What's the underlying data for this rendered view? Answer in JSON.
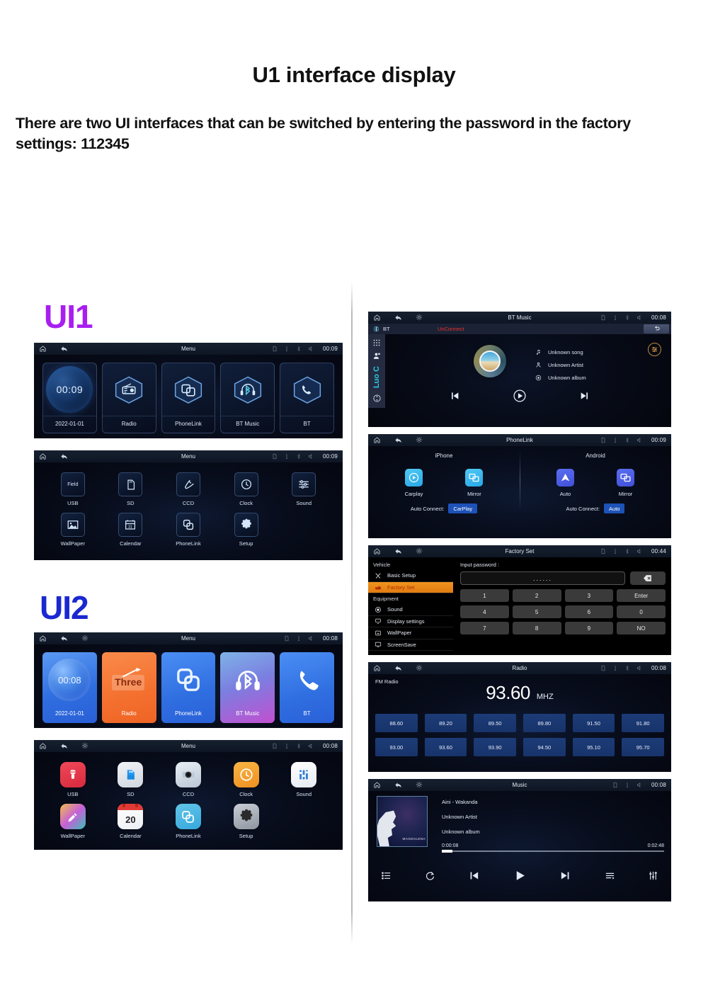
{
  "header": {
    "title": "U1 interface display",
    "subtitle": "There are two UI interfaces that can be switched by entering the password in the factory settings: 112345"
  },
  "labels": {
    "ui1": "UI1",
    "ui2": "UI2",
    "ui1_color": "#a81ef0",
    "ui2_color": "#1a28d0"
  },
  "ui1_home": {
    "statusbar": {
      "title": "Menu",
      "time": "00:09"
    },
    "tiles": [
      {
        "label": "2022-01-01",
        "icon": "clock-sphere-icon",
        "value": "00:09"
      },
      {
        "label": "Radio",
        "icon": "radio-icon"
      },
      {
        "label": "PhoneLink",
        "icon": "phonelink-icon"
      },
      {
        "label": "BT Music",
        "icon": "bt-music-icon"
      },
      {
        "label": "BT",
        "icon": "phone-icon"
      }
    ]
  },
  "ui1_apps": {
    "statusbar": {
      "title": "Menu",
      "time": "00:09"
    },
    "row1": [
      {
        "label": "USB",
        "icon": "usb-icon",
        "badge": "Field"
      },
      {
        "label": "SD",
        "icon": "sd-card-icon"
      },
      {
        "label": "CCD",
        "icon": "camera-plug-icon"
      },
      {
        "label": "Clock",
        "icon": "clock-icon"
      },
      {
        "label": "Sound",
        "icon": "sound-sliders-icon"
      }
    ],
    "row2": [
      {
        "label": "WallPaper",
        "icon": "image-icon"
      },
      {
        "label": "Calendar",
        "icon": "calendar-icon",
        "day": "31"
      },
      {
        "label": "PhoneLink",
        "icon": "phonelink-icon"
      },
      {
        "label": "Setup",
        "icon": "gear-icon"
      }
    ]
  },
  "ui2_home": {
    "statusbar": {
      "title": "Menu",
      "time": "00:08"
    },
    "tiles": [
      {
        "label": "2022-01-01",
        "icon": "clock-sphere-icon",
        "value": "00:08"
      },
      {
        "label": "Radio",
        "icon": "radio-icon",
        "badge": "Three"
      },
      {
        "label": "PhoneLink",
        "icon": "phonelink-icon"
      },
      {
        "label": "BT Music",
        "icon": "bt-music-icon"
      },
      {
        "label": "BT",
        "icon": "phone-icon"
      }
    ]
  },
  "ui2_apps": {
    "statusbar": {
      "title": "Menu",
      "time": "00:08"
    },
    "row1": [
      {
        "label": "USB",
        "icon": "usb-icon"
      },
      {
        "label": "SD",
        "icon": "sd-card-icon"
      },
      {
        "label": "CCD",
        "icon": "camera-icon"
      },
      {
        "label": "Clock",
        "icon": "clock-icon"
      },
      {
        "label": "Sound",
        "icon": "sound-sliders-icon"
      }
    ],
    "row2": [
      {
        "label": "WallPaper",
        "icon": "image-icon"
      },
      {
        "label": "Calendar",
        "icon": "calendar-icon",
        "day": "20"
      },
      {
        "label": "PhoneLink",
        "icon": "phonelink-icon"
      },
      {
        "label": "Setup",
        "icon": "gear-icon"
      }
    ]
  },
  "bt_music": {
    "statusbar": {
      "title": "BT Music",
      "time": "00:08"
    },
    "subbar": {
      "device": "BT",
      "status": "UnConnect"
    },
    "rail": {
      "vertical_text": "Luo C"
    },
    "meta": [
      {
        "icon": "music-note-icon",
        "text": "Unknown song"
      },
      {
        "icon": "person-icon",
        "text": "Unknown Artist"
      },
      {
        "icon": "disc-icon",
        "text": "Unknown album"
      }
    ],
    "controls": [
      "prev-icon",
      "play-icon",
      "next-icon"
    ]
  },
  "phonelink": {
    "statusbar": {
      "title": "PhoneLink",
      "time": "00:09"
    },
    "iphone": {
      "heading": "iPhone",
      "items": [
        {
          "label": "Carplay",
          "icon": "carplay-icon"
        },
        {
          "label": "Mirror",
          "icon": "mirror-icon"
        }
      ],
      "auto_connect_label": "Auto Connect:",
      "auto_connect_value": "CarPlay"
    },
    "android": {
      "heading": "Android",
      "items": [
        {
          "label": "Auto",
          "icon": "android-auto-icon"
        },
        {
          "label": "Mirror",
          "icon": "mirror-icon"
        }
      ],
      "auto_connect_label": "Auto Connect:",
      "auto_connect_value": "Auto"
    }
  },
  "factory_set": {
    "statusbar": {
      "title": "Factory Set",
      "time": "00:44"
    },
    "sidebar": [
      {
        "type": "group",
        "label": "Vehicle"
      },
      {
        "type": "item",
        "label": "Basic Setup",
        "icon": "tools-icon",
        "active": false
      },
      {
        "type": "item",
        "label": "Factory Set",
        "icon": "factory-icon",
        "active": true
      },
      {
        "type": "group",
        "label": "Equipment"
      },
      {
        "type": "item",
        "label": "Sound",
        "icon": "speaker-icon",
        "active": false
      },
      {
        "type": "item",
        "label": "Display settings",
        "icon": "display-icon",
        "active": false
      },
      {
        "type": "item",
        "label": "WallPaper",
        "icon": "wallpaper-icon",
        "active": false
      },
      {
        "type": "item",
        "label": "ScreenSave",
        "icon": "screen-icon",
        "active": false
      }
    ],
    "input_label": "Input password :",
    "password_value": "......",
    "delete_icon": "backspace-icon",
    "keys": [
      "1",
      "2",
      "3",
      "Enter",
      "4",
      "5",
      "6",
      "0",
      "7",
      "8",
      "9",
      "NO"
    ]
  },
  "radio": {
    "statusbar": {
      "title": "Radio",
      "time": "00:08"
    },
    "band": "FM Radio",
    "frequency": "93.60",
    "unit": "MHZ",
    "presets": [
      "88.60",
      "89.20",
      "89.50",
      "89.80",
      "91.50",
      "91.80",
      "93.00",
      "93.60",
      "93.90",
      "94.50",
      "95.10",
      "95.70"
    ]
  },
  "music": {
    "statusbar": {
      "title": "Music",
      "time": "00:08"
    },
    "album_caption": "MAGDALENA",
    "track": "Aini - Wakanda",
    "artist": "Unknown Artist",
    "album": "Unknown album",
    "elapsed": "0:00:08",
    "duration": "0:02:48",
    "controls": [
      "list-icon",
      "repeat-icon",
      "prev-icon",
      "play-icon",
      "next-icon",
      "playlist-icon",
      "equalizer-icon"
    ]
  }
}
